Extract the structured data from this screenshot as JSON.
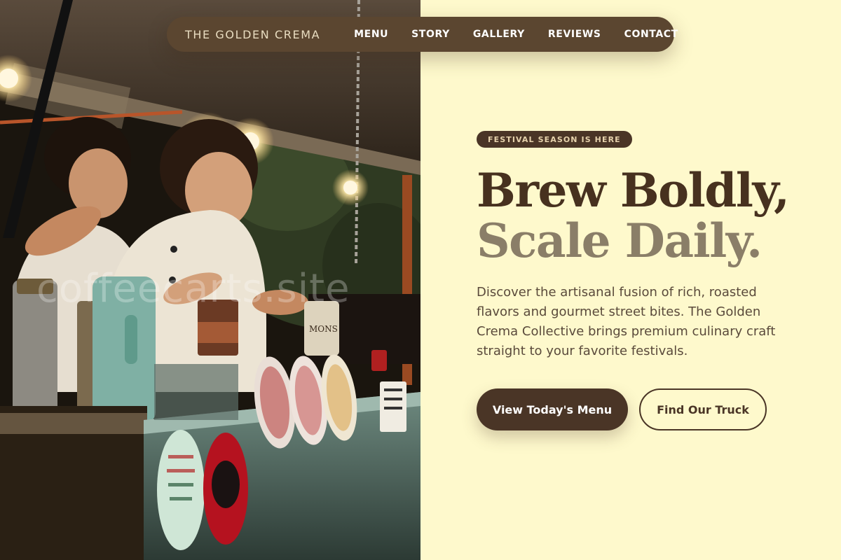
{
  "nav": {
    "brand": "THE GOLDEN CREMA",
    "links": [
      "MENU",
      "STORY",
      "GALLERY",
      "REVIEWS",
      "CONTACT"
    ]
  },
  "hero": {
    "badge": "FESTIVAL SEASON IS HERE",
    "headline_line1": "Brew Boldly,",
    "headline_line2": "Scale Daily.",
    "description": "Discover the artisanal fusion of rich, roasted flavors and gourmet street bites. The Golden Crema Collective brings premium culinary craft straight to your favorite festivals.",
    "primary_cta": "View Today's Menu",
    "secondary_cta": "Find Our Truck"
  },
  "photo": {
    "watermark": "coffeecarts.site",
    "sign_text": "MONS"
  },
  "colors": {
    "background": "#FEF9CC",
    "nav_bg": "#5B4630",
    "accent_dark": "#4A3526",
    "headline_muted": "#8A7E68"
  }
}
